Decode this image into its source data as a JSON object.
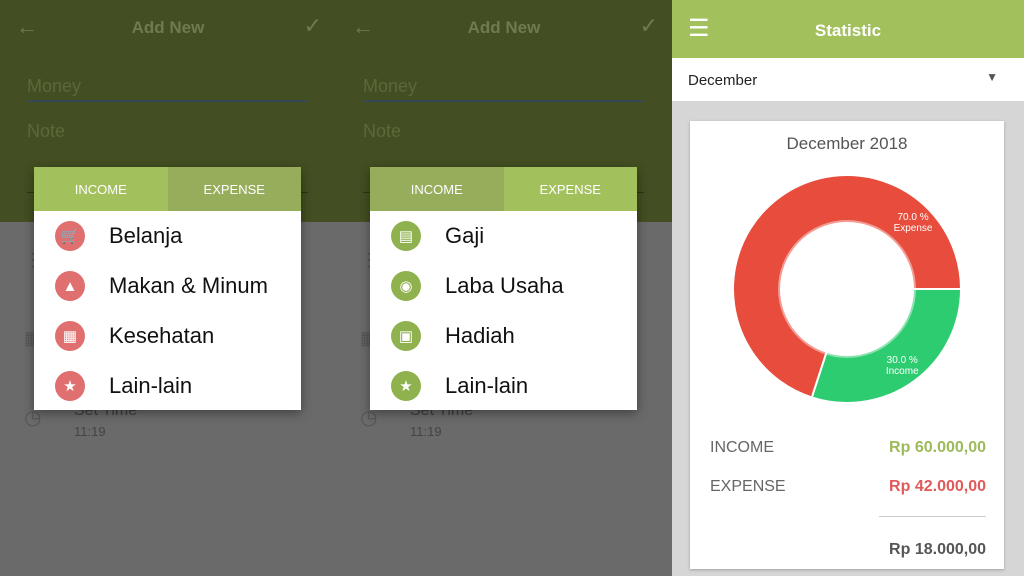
{
  "add_new": {
    "title": "Add New",
    "back_icon": "arrow-left-icon",
    "confirm_icon": "check-icon",
    "money_placeholder": "Money",
    "note_placeholder": "Note",
    "set_time_label": "Set Time",
    "set_time_value": "11:19"
  },
  "dialogs": [
    {
      "tabs": [
        "INCOME",
        "EXPENSE"
      ],
      "active_tab": "INCOME",
      "color": "#e07070",
      "items": [
        {
          "label": "Belanja",
          "icon": "cart-icon"
        },
        {
          "label": "Makan & Minum",
          "icon": "cake-icon"
        },
        {
          "label": "Kesehatan",
          "icon": "hospital-icon"
        },
        {
          "label": "Lain-lain",
          "icon": "juggle-icon"
        }
      ]
    },
    {
      "tabs": [
        "INCOME",
        "EXPENSE"
      ],
      "active_tab": "EXPENSE",
      "color": "#8fb24f",
      "items": [
        {
          "label": "Gaji",
          "icon": "cash-icon"
        },
        {
          "label": "Laba Usaha",
          "icon": "money-bag-icon"
        },
        {
          "label": "Hadiah",
          "icon": "gift-icon"
        },
        {
          "label": "Lain-lain",
          "icon": "juggle-icon"
        }
      ]
    }
  ],
  "statistic": {
    "title": "Statistic",
    "menu_icon": "hamburger-icon",
    "month": "December",
    "card_title": "December 2018",
    "income_label": "INCOME",
    "income_value": "Rp 60.000,00",
    "expense_label": "EXPENSE",
    "expense_value": "Rp 42.000,00",
    "balance_value": "Rp 18.000,00",
    "colors": {
      "accent": "#a2c05c",
      "income": "#9dbb5a",
      "expense": "#e05a5a"
    }
  },
  "chart_data": {
    "type": "pie",
    "donut": true,
    "categories": [
      "Income",
      "Expense"
    ],
    "values": [
      30.0,
      70.0
    ],
    "labels": [
      "30.0 %",
      "70.0 %"
    ],
    "colors": [
      "#2ecc71",
      "#e74c3c"
    ]
  }
}
